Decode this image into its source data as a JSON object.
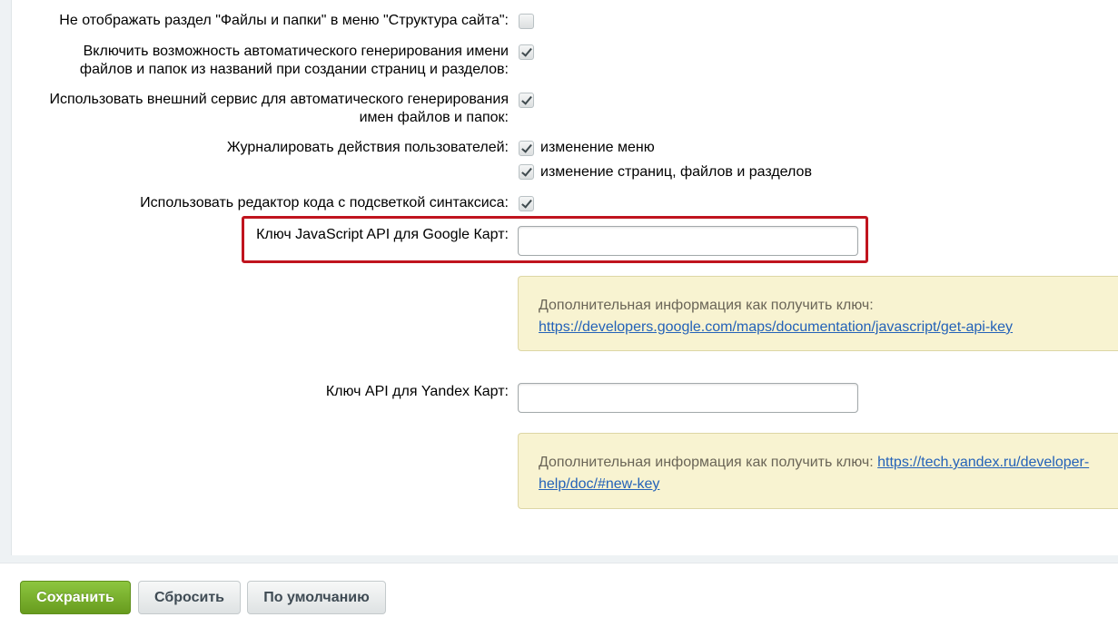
{
  "settings": {
    "hide_files_section": {
      "label": "Не отображать раздел \"Файлы и папки\" в меню \"Структура сайта\":",
      "checked": false
    },
    "auto_generate_names": {
      "label_line1": "Включить возможность автоматического генерирования имени",
      "label_line2": "файлов и папок из названий при создании страниц и разделов:",
      "checked": true
    },
    "external_service": {
      "label_line1": "Использовать внешний сервис для автоматического генерирования",
      "label_line2": "имен файлов и папок:",
      "checked": true
    },
    "log_user_actions": {
      "label": "Журналировать действия пользователей:",
      "options": [
        {
          "label": "изменение меню",
          "checked": true
        },
        {
          "label": "изменение страниц, файлов и разделов",
          "checked": true
        }
      ]
    },
    "code_editor": {
      "label": "Использовать редактор кода с подсветкой синтаксиса:",
      "checked": true
    },
    "google_maps_key": {
      "label": "Ключ JavaScript API для Google Карт:",
      "value": ""
    },
    "google_note": {
      "text": "Дополнительная информация как получить ключ:",
      "link": "https://developers.google.com/maps/documentation/javascript/get-api-key"
    },
    "yandex_maps_key": {
      "label": "Ключ API для Yandex Карт:",
      "value": ""
    },
    "yandex_note": {
      "text": "Дополнительная информация как получить ключ:",
      "link_line1": "https://tech.yandex.ru/developer-",
      "link_line2": "help/doc/#new-key"
    }
  },
  "footer": {
    "save_label": "Сохранить",
    "reset_label": "Сбросить",
    "default_label": "По умолчанию"
  },
  "colors": {
    "highlight": "#c0141e",
    "save_button": "#7ab22f",
    "note_background": "#f8f3d1",
    "link": "#2462b8"
  }
}
